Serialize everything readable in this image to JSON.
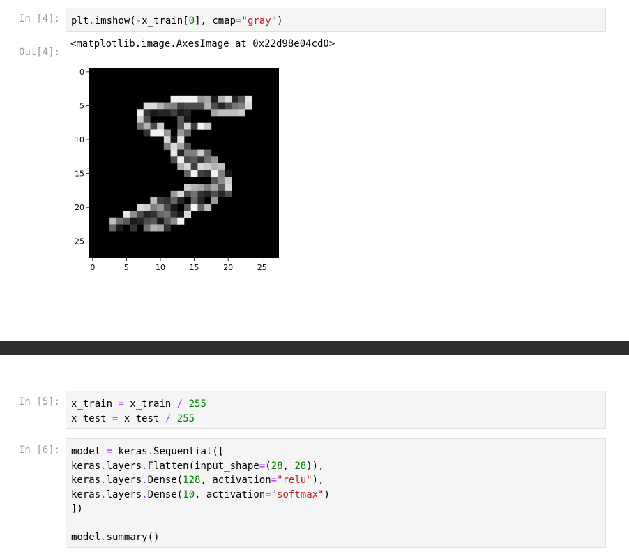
{
  "cells": [
    {
      "prompt": "In [4]:",
      "code": [
        [
          [
            "plt",
            ""
          ],
          [
            ".",
            "op"
          ],
          [
            "imshow(",
            ""
          ],
          [
            "-",
            "op"
          ],
          [
            "x_train[",
            ""
          ],
          [
            "0",
            "num"
          ],
          [
            "], cmap",
            ""
          ],
          [
            "=",
            "op"
          ],
          [
            "\"gray\"",
            "str"
          ],
          [
            ")",
            ""
          ]
        ]
      ]
    },
    {
      "prompt": "In [5]:",
      "code": [
        [
          [
            "x_train ",
            ""
          ],
          [
            "=",
            "op"
          ],
          [
            " x_train ",
            ""
          ],
          [
            "/",
            "op"
          ],
          [
            " ",
            ""
          ],
          [
            "255",
            "num"
          ]
        ],
        [
          [
            "x_test ",
            ""
          ],
          [
            "=",
            "op"
          ],
          [
            " x_test ",
            ""
          ],
          [
            "/",
            "op"
          ],
          [
            " ",
            ""
          ],
          [
            "255",
            "num"
          ]
        ]
      ]
    },
    {
      "prompt": "In [6]:",
      "code": [
        [
          [
            "model ",
            ""
          ],
          [
            "=",
            "op"
          ],
          [
            " keras",
            ""
          ],
          [
            ".",
            "op"
          ],
          [
            "Sequential([",
            ""
          ]
        ],
        [
          [
            "keras",
            ""
          ],
          [
            ".",
            "op"
          ],
          [
            "layers",
            ""
          ],
          [
            ".",
            "op"
          ],
          [
            "Flatten(input_shape",
            ""
          ],
          [
            "=",
            "op"
          ],
          [
            "(",
            ""
          ],
          [
            "28",
            "num"
          ],
          [
            ", ",
            ""
          ],
          [
            "28",
            "num"
          ],
          [
            ")),",
            ""
          ]
        ],
        [
          [
            "keras",
            ""
          ],
          [
            ".",
            "op"
          ],
          [
            "layers",
            ""
          ],
          [
            ".",
            "op"
          ],
          [
            "Dense(",
            ""
          ],
          [
            "128",
            "num"
          ],
          [
            ", activation",
            ""
          ],
          [
            "=",
            "op"
          ],
          [
            "\"relu\"",
            "str"
          ],
          [
            "),",
            ""
          ]
        ],
        [
          [
            "keras",
            ""
          ],
          [
            ".",
            "op"
          ],
          [
            "layers",
            ""
          ],
          [
            ".",
            "op"
          ],
          [
            "Dense(",
            ""
          ],
          [
            "10",
            "num"
          ],
          [
            ", activation",
            ""
          ],
          [
            "=",
            "op"
          ],
          [
            "\"softmax\"",
            "str"
          ],
          [
            ")",
            ""
          ]
        ],
        [
          [
            "])",
            ""
          ]
        ],
        [
          [
            "",
            ""
          ]
        ],
        [
          [
            "model",
            ""
          ],
          [
            ".",
            "op"
          ],
          [
            "summary()",
            ""
          ]
        ]
      ]
    }
  ],
  "output": {
    "prompt": "Out[4]:",
    "text": "<matplotlib.image.AxesImage at 0x22d98e04cd0>"
  },
  "chart_data": {
    "type": "heatmap",
    "colormap": "gray",
    "title": "",
    "xlabel": "",
    "ylabel": "",
    "xlim": [
      -0.5,
      27.5
    ],
    "ylim": [
      27.5,
      -0.5
    ],
    "xticks": [
      "0",
      "5",
      "10",
      "15",
      "20",
      "25"
    ],
    "yticks": [
      "0",
      "5",
      "10",
      "15",
      "20",
      "25"
    ],
    "xtick_values": [
      0,
      5,
      10,
      15,
      20,
      25
    ],
    "ytick_values": [
      0,
      5,
      10,
      15,
      20,
      25
    ],
    "shape": [
      28,
      28
    ],
    "values": [
      [
        0,
        0,
        0,
        0,
        0,
        0,
        0,
        0,
        0,
        0,
        0,
        0,
        0,
        0,
        0,
        0,
        0,
        0,
        0,
        0,
        0,
        0,
        0,
        0,
        0,
        0,
        0,
        0
      ],
      [
        0,
        0,
        0,
        0,
        0,
        0,
        0,
        0,
        0,
        0,
        0,
        0,
        0,
        0,
        0,
        0,
        0,
        0,
        0,
        0,
        0,
        0,
        0,
        0,
        0,
        0,
        0,
        0
      ],
      [
        0,
        0,
        0,
        0,
        0,
        0,
        0,
        0,
        0,
        0,
        0,
        0,
        0,
        0,
        0,
        0,
        0,
        0,
        0,
        0,
        0,
        0,
        0,
        0,
        0,
        0,
        0,
        0
      ],
      [
        0,
        0,
        0,
        0,
        0,
        0,
        0,
        0,
        0,
        0,
        0,
        0,
        0,
        0,
        0,
        0,
        0,
        0,
        0,
        0,
        0,
        0,
        0,
        0,
        0,
        0,
        0,
        0
      ],
      [
        0,
        0,
        0,
        0,
        0,
        0,
        0,
        0,
        0,
        0,
        0,
        0,
        0.95,
        0.95,
        0.95,
        0.95,
        0.6,
        0.65,
        0.1,
        0.7,
        0.85,
        0.15,
        0.35,
        0.9,
        0,
        0,
        0,
        0
      ],
      [
        0,
        0,
        0,
        0,
        0,
        0,
        0,
        0,
        0.85,
        0.85,
        0.7,
        0.55,
        0.5,
        0.25,
        0.3,
        0.3,
        0.3,
        0.7,
        0.3,
        0.15,
        0.3,
        0.45,
        0.5,
        0.85,
        0,
        0,
        0,
        0
      ],
      [
        0,
        0,
        0,
        0,
        0,
        0,
        0,
        0.95,
        0.2,
        0.1,
        0.15,
        0.15,
        0.25,
        0.1,
        0.15,
        0,
        0,
        0,
        0.65,
        0.75,
        0.75,
        0.75,
        0.8,
        0,
        0,
        0,
        0,
        0
      ],
      [
        0,
        0,
        0,
        0,
        0,
        0,
        0,
        0.8,
        0.3,
        0,
        0,
        0,
        0,
        0.35,
        0.1,
        0,
        0,
        0,
        0,
        0,
        0,
        0,
        0,
        0,
        0,
        0,
        0,
        0
      ],
      [
        0,
        0,
        0,
        0,
        0,
        0,
        0,
        0.45,
        0.7,
        0.3,
        0.8,
        0,
        0,
        0.35,
        0.85,
        0.25,
        0.95,
        0.8,
        0,
        0,
        0,
        0,
        0,
        0,
        0,
        0,
        0,
        0
      ],
      [
        0,
        0,
        0,
        0,
        0,
        0,
        0,
        0,
        0.2,
        0.95,
        0.95,
        0.6,
        0,
        0.6,
        0.4,
        0,
        0,
        0,
        0,
        0,
        0,
        0,
        0,
        0,
        0,
        0,
        0,
        0
      ],
      [
        0,
        0,
        0,
        0,
        0,
        0,
        0,
        0,
        0,
        0,
        0,
        0.85,
        0.1,
        0.9,
        0,
        0,
        0,
        0,
        0,
        0,
        0,
        0,
        0,
        0,
        0,
        0,
        0,
        0
      ],
      [
        0,
        0,
        0,
        0,
        0,
        0,
        0,
        0,
        0,
        0,
        0,
        0.5,
        0.85,
        0.65,
        0.3,
        0,
        0,
        0,
        0,
        0,
        0,
        0,
        0,
        0,
        0,
        0,
        0,
        0
      ],
      [
        0,
        0,
        0,
        0,
        0,
        0,
        0,
        0,
        0,
        0,
        0,
        0,
        0.9,
        0.15,
        0.5,
        0.5,
        0.8,
        0.4,
        0,
        0,
        0,
        0,
        0,
        0,
        0,
        0,
        0,
        0
      ],
      [
        0,
        0,
        0,
        0,
        0,
        0,
        0,
        0,
        0,
        0,
        0,
        0,
        0.3,
        0.95,
        0.3,
        0.35,
        0.2,
        0.45,
        0.6,
        0,
        0,
        0,
        0,
        0,
        0,
        0,
        0,
        0
      ],
      [
        0,
        0,
        0,
        0,
        0,
        0,
        0,
        0,
        0,
        0,
        0,
        0,
        0,
        0.7,
        0.85,
        0.25,
        0.85,
        0.8,
        0.7,
        0.75,
        0,
        0,
        0,
        0,
        0,
        0,
        0,
        0
      ],
      [
        0,
        0,
        0,
        0,
        0,
        0,
        0,
        0,
        0,
        0,
        0,
        0,
        0,
        0,
        0.4,
        0.95,
        0.25,
        0.2,
        0.95,
        0.5,
        0.1,
        0,
        0,
        0,
        0,
        0,
        0,
        0
      ],
      [
        0,
        0,
        0,
        0,
        0,
        0,
        0,
        0,
        0,
        0,
        0,
        0,
        0,
        0,
        0,
        0,
        0,
        0,
        0.35,
        0.55,
        0.8,
        0,
        0,
        0,
        0,
        0,
        0,
        0
      ],
      [
        0,
        0,
        0,
        0,
        0,
        0,
        0,
        0,
        0,
        0,
        0,
        0,
        0,
        0,
        0.8,
        0.7,
        0.65,
        0.5,
        0.65,
        0.35,
        0.85,
        0,
        0,
        0,
        0,
        0,
        0,
        0
      ],
      [
        0,
        0,
        0,
        0,
        0,
        0,
        0,
        0,
        0,
        0,
        0,
        0,
        0.6,
        0.85,
        0.3,
        0.45,
        0.2,
        0.15,
        0.3,
        0.15,
        0.3,
        0,
        0,
        0,
        0,
        0,
        0,
        0
      ],
      [
        0,
        0,
        0,
        0,
        0,
        0,
        0,
        0,
        0,
        0.75,
        0.25,
        0.2,
        0.4,
        0.15,
        0,
        0.4,
        0.15,
        0,
        0.6,
        0,
        0,
        0,
        0,
        0,
        0,
        0,
        0,
        0
      ],
      [
        0,
        0,
        0,
        0,
        0,
        0,
        0,
        0.85,
        0.8,
        0.5,
        0.6,
        0.3,
        0.1,
        0,
        0.35,
        0.95,
        0.4,
        0.75,
        0,
        0,
        0,
        0,
        0,
        0,
        0,
        0,
        0,
        0
      ],
      [
        0,
        0,
        0,
        0,
        0,
        0.9,
        0.55,
        0.3,
        0.15,
        0.2,
        0.4,
        0.45,
        0.2,
        0.1,
        0.85,
        0,
        0,
        0,
        0,
        0,
        0,
        0,
        0,
        0,
        0,
        0,
        0,
        0
      ],
      [
        0,
        0,
        0,
        0.75,
        0.45,
        0.35,
        0.1,
        0.15,
        0.3,
        0.35,
        0.1,
        0.35,
        0.55,
        0.95,
        0,
        0,
        0,
        0,
        0,
        0,
        0,
        0,
        0,
        0,
        0,
        0,
        0,
        0
      ],
      [
        0,
        0,
        0,
        0.4,
        0.1,
        0,
        0.2,
        0,
        0.45,
        0.7,
        0.65,
        0.2,
        0,
        0,
        0,
        0,
        0,
        0,
        0,
        0,
        0,
        0,
        0,
        0,
        0,
        0,
        0,
        0
      ],
      [
        0,
        0,
        0,
        0,
        0,
        0,
        0,
        0,
        0,
        0,
        0,
        0,
        0,
        0,
        0,
        0,
        0,
        0,
        0,
        0,
        0,
        0,
        0,
        0,
        0,
        0,
        0,
        0
      ],
      [
        0,
        0,
        0,
        0,
        0,
        0,
        0,
        0,
        0,
        0,
        0,
        0,
        0,
        0,
        0,
        0,
        0,
        0,
        0,
        0,
        0,
        0,
        0,
        0,
        0,
        0,
        0,
        0
      ],
      [
        0,
        0,
        0,
        0,
        0,
        0,
        0,
        0,
        0,
        0,
        0,
        0,
        0,
        0,
        0,
        0,
        0,
        0,
        0,
        0,
        0,
        0,
        0,
        0,
        0,
        0,
        0,
        0
      ],
      [
        0,
        0,
        0,
        0,
        0,
        0,
        0,
        0,
        0,
        0,
        0,
        0,
        0,
        0,
        0,
        0,
        0,
        0,
        0,
        0,
        0,
        0,
        0,
        0,
        0,
        0,
        0,
        0
      ]
    ]
  }
}
